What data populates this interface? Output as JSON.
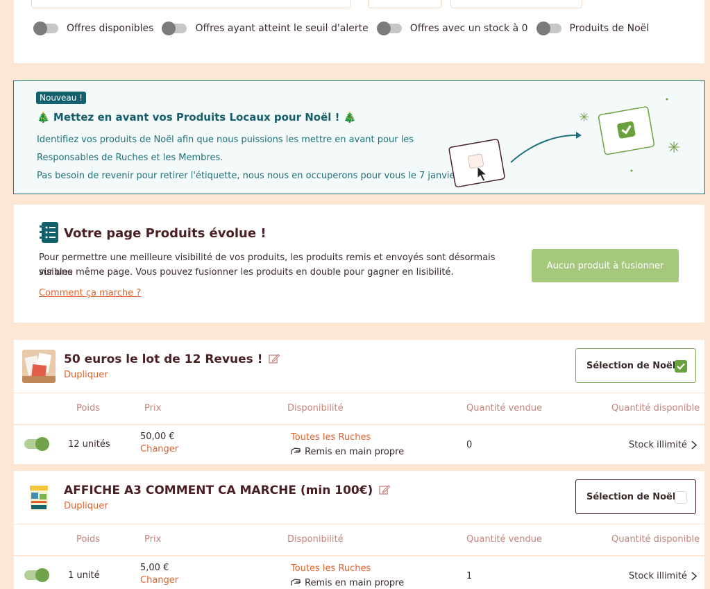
{
  "filters": {
    "toggles": [
      {
        "label": "Offres disponibles"
      },
      {
        "label": "Offres ayant atteint le seuil d'alerte"
      },
      {
        "label": "Offres avec un stock à 0"
      },
      {
        "label": "Produits de Noël"
      }
    ]
  },
  "noel_banner": {
    "badge": "Nouveau !",
    "title": "🎄 Mettez en avant vos Produits Locaux pour Noël ! 🎄",
    "line1": "Identifiez vos produits de Noël afin que nous puissions les mettre en avant pour les",
    "line2": "Responsables de Ruches et les Membres.",
    "line3": "Pas besoin de revenir pour retirer l'étiquette, nous nous en occuperons pour vous le 7 janvier."
  },
  "evolve": {
    "title": "Votre page Produits évolue !",
    "line1": "Pour permettre une meilleure visibilité de vos produits, les produits remis et envoyés sont désormais visibles",
    "line2": "sur une même page. Vous pouvez fusionner les produits en double pour gagner en lisibilité.",
    "link": "Comment ça marche ?",
    "merge_button": "Aucun produit à fusionner"
  },
  "columns": {
    "poids": "Poids",
    "prix": "Prix",
    "disponibilite": "Disponibilité",
    "quantite_vendue": "Quantité vendue",
    "quantite_disponible": "Quantité disponible"
  },
  "products": [
    {
      "name": "50 euros le lot de 12 Revues !",
      "duplicate": "Dupliquer",
      "selection_label": "Sélection de Noël",
      "selected": true,
      "weight": "12 unités",
      "price": "50,00 €",
      "change": "Changer",
      "availability": "Toutes les Ruches",
      "delivery": "Remis en main propre",
      "sold": "0",
      "stock": "Stock illimité"
    },
    {
      "name": "AFFICHE A3 COMMENT CA MARCHE (min 100€)",
      "duplicate": "Dupliquer",
      "selection_label": "Sélection de Noël",
      "selected": false,
      "weight": "1 unité",
      "price": "5,00 €",
      "change": "Changer",
      "availability": "Toutes les Ruches",
      "delivery": "Remis en main propre",
      "sold": "1",
      "stock": "Stock illimité"
    }
  ]
}
